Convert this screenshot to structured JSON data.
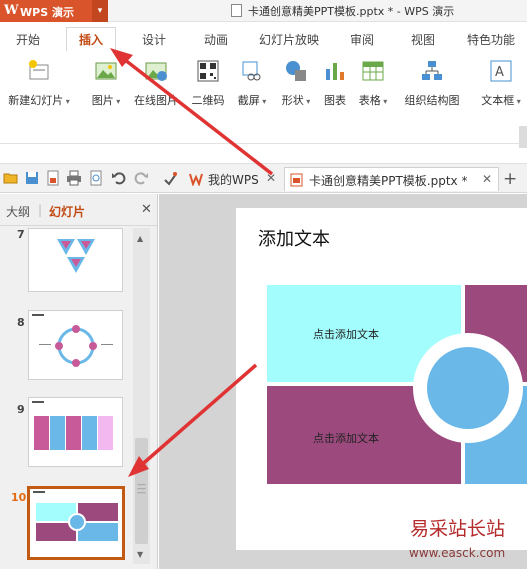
{
  "app": {
    "logo": "W",
    "name": "WPS 演示",
    "caret": "▾"
  },
  "window": {
    "title": "卡通创意精美PPT模板.pptx * - WPS 演示"
  },
  "ribbon_tabs": [
    "开始",
    "插入",
    "设计",
    "动画",
    "幻灯片放映",
    "审阅",
    "视图",
    "特色功能"
  ],
  "active_tab": "插入",
  "ribbon": [
    {
      "label": "新建幻灯片",
      "icon": "new-slide-icon",
      "dropdown": true
    },
    {
      "label": "图片",
      "icon": "picture-icon",
      "dropdown": true
    },
    {
      "label": "在线图片",
      "icon": "online-picture-icon",
      "dropdown": false
    },
    {
      "label": "二维码",
      "icon": "qr-code-icon",
      "dropdown": false
    },
    {
      "label": "截屏",
      "icon": "screenshot-icon",
      "dropdown": true
    },
    {
      "label": "形状",
      "icon": "shapes-icon",
      "dropdown": true
    },
    {
      "label": "图表",
      "icon": "chart-icon",
      "dropdown": false
    },
    {
      "label": "表格",
      "icon": "table-icon",
      "dropdown": true
    },
    {
      "label": "组织结构图",
      "icon": "org-chart-icon",
      "dropdown": false
    },
    {
      "label": "文本框",
      "icon": "textbox-icon",
      "dropdown": true
    }
  ],
  "doc_tabs": [
    {
      "label": "我的WPS",
      "icon": "wps-home-icon"
    },
    {
      "label": "卡通创意精美PPT模板.pptx *",
      "icon": "document-icon"
    }
  ],
  "left_panel": {
    "outline_tab": "大纲",
    "slides_tab": "幻灯片",
    "separator": "|"
  },
  "slides": [
    {
      "number": "7",
      "layout": "triangles"
    },
    {
      "number": "8",
      "layout": "circle"
    },
    {
      "number": "9",
      "layout": "columns"
    },
    {
      "number": "10",
      "layout": "quadrants",
      "selected": true
    }
  ],
  "slide": {
    "title": "添加文本",
    "placeholders": [
      "点击添加文本",
      "点击添加文本"
    ]
  },
  "colors": {
    "accent": "#c14a13",
    "app_orange": "#d9542b",
    "cyan": "#a4fdfd",
    "purple": "#9c4a7e",
    "blue": "#6ab8e8",
    "arrow_red": "#e03434"
  },
  "watermark": {
    "text": "易采站长站",
    "url": "www.easck.com"
  }
}
